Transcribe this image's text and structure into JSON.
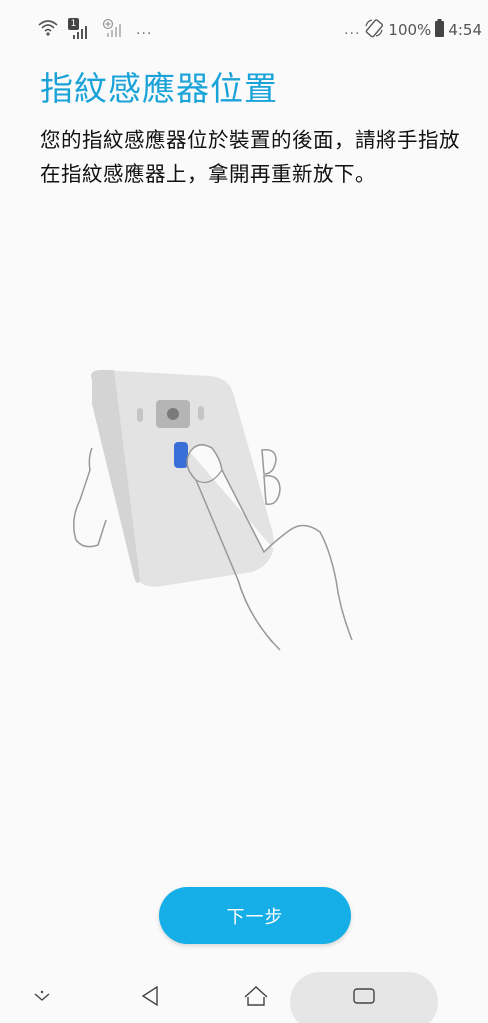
{
  "status_bar": {
    "left_dots": "...",
    "right_dots": "...",
    "battery": "100%",
    "time": "4:54",
    "sim1_badge": "1"
  },
  "screen": {
    "title": "指紋感應器位置",
    "description": "您的指紋感應器位於裝置的後面，請將手指放在指紋感應器上，拿開再重新放下。"
  },
  "actions": {
    "next_label": "下一步"
  },
  "nav": {
    "items": [
      "notification-pull-icon",
      "back-icon",
      "home-icon",
      "recents-icon"
    ]
  },
  "colors": {
    "accent": "#1aa3d8",
    "button": "#15aee6",
    "sensor": "#3b6fd8"
  }
}
